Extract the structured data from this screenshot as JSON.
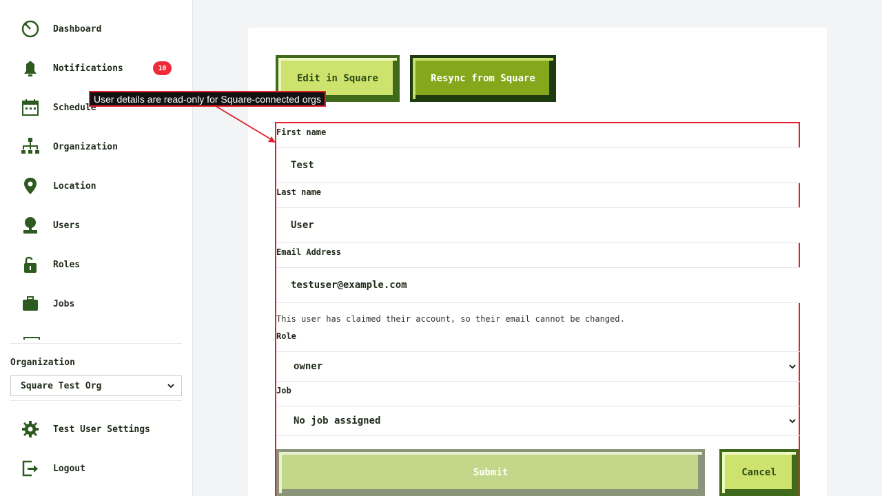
{
  "sidebar": {
    "items": [
      {
        "label": "Dashboard",
        "icon": "dashboard-icon"
      },
      {
        "label": "Notifications",
        "icon": "bell-icon",
        "badge": "10"
      },
      {
        "label": "Schedule",
        "icon": "calendar-icon"
      },
      {
        "label": "Organization",
        "icon": "org-chart-icon"
      },
      {
        "label": "Location",
        "icon": "location-pin-icon"
      },
      {
        "label": "Users",
        "icon": "user-icon"
      },
      {
        "label": "Roles",
        "icon": "unlock-icon"
      },
      {
        "label": "Jobs",
        "icon": "briefcase-icon"
      }
    ],
    "organization": {
      "label": "Organization",
      "selected": "Square Test Org"
    },
    "settings_label": "Test User Settings",
    "logout_label": "Logout"
  },
  "actions": {
    "edit_label": "Edit in Square",
    "resync_label": "Resync from Square"
  },
  "form": {
    "first_name": {
      "label": "First name",
      "value": "Test"
    },
    "last_name": {
      "label": "Last name",
      "value": "User"
    },
    "email": {
      "label": "Email Address",
      "value": "testuser@example.com",
      "help": "This user has claimed their account, so their email cannot be changed."
    },
    "role": {
      "label": "Role",
      "selected": "owner"
    },
    "job": {
      "label": "Job",
      "selected": "No job assigned"
    },
    "submit_label": "Submit",
    "cancel_label": "Cancel"
  },
  "annotation": {
    "text": "User details are read-only for Square-connected orgs"
  },
  "colors": {
    "accent_green": "#84a71b",
    "light_green": "#cde36e",
    "dark_green": "#2d5a1f",
    "badge_red": "#ef2b3a",
    "annotation_red": "#e5202a"
  }
}
